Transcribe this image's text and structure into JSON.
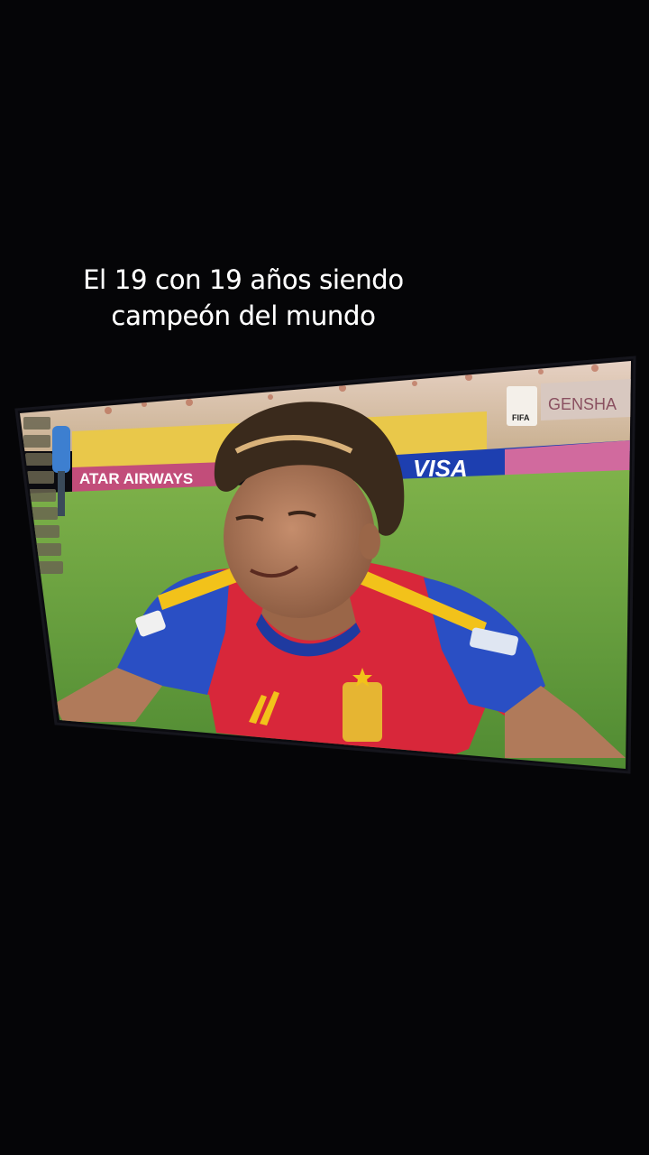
{
  "caption": {
    "line1": "El 19 con 19 años siendo",
    "line2": "campeón del mundo"
  },
  "broadcast": {
    "banner_left": "ATAR AIRWAYS",
    "banner_right": "VISA",
    "board_top_right": "GENSHA",
    "badge_text": "FIFA"
  },
  "colors": {
    "background": "#050507",
    "pitch": "#5f9a3e",
    "jersey_red": "#d8273a",
    "jersey_blue": "#2a4fc4",
    "trim_yellow": "#f2c21a"
  }
}
